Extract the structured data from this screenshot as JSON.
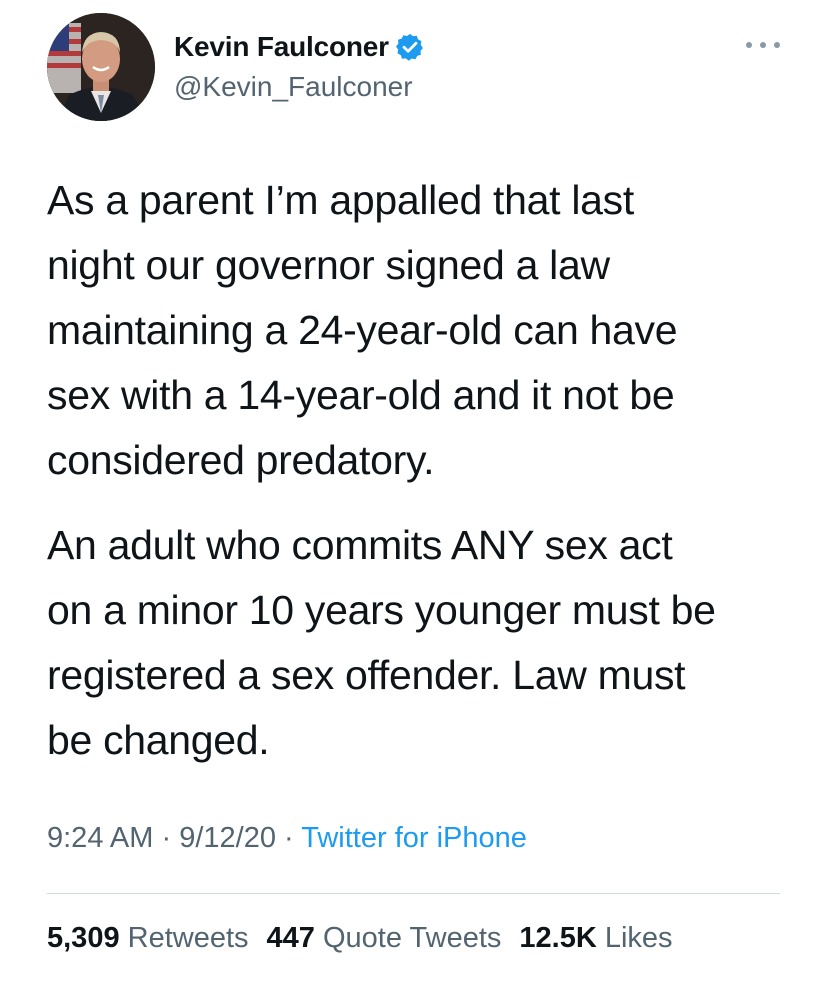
{
  "author": {
    "display_name": "Kevin Faulconer",
    "handle": "@Kevin_Faulconer",
    "verified_icon": "verified-badge-icon",
    "accent_color": "#1d9bf0"
  },
  "tweet": {
    "paragraphs": [
      "As a parent I’m appalled that last\nnight our governor signed a law\nmaintaining a 24-year-old can have\nsex with a 14-year-old and it not be\nconsidered predatory.",
      "An adult who commits ANY sex act\non a minor 10 years younger must be\nregistered a sex offender. Law must\nbe changed."
    ],
    "time": "9:24 AM",
    "separator": "·",
    "date": "9/12/20",
    "source": "Twitter for iPhone"
  },
  "stats": {
    "retweets_count": "5,309",
    "retweets_label": "Retweets",
    "quotes_count": "447",
    "quotes_label": "Quote Tweets",
    "likes_count": "12.5K",
    "likes_label": "Likes"
  }
}
